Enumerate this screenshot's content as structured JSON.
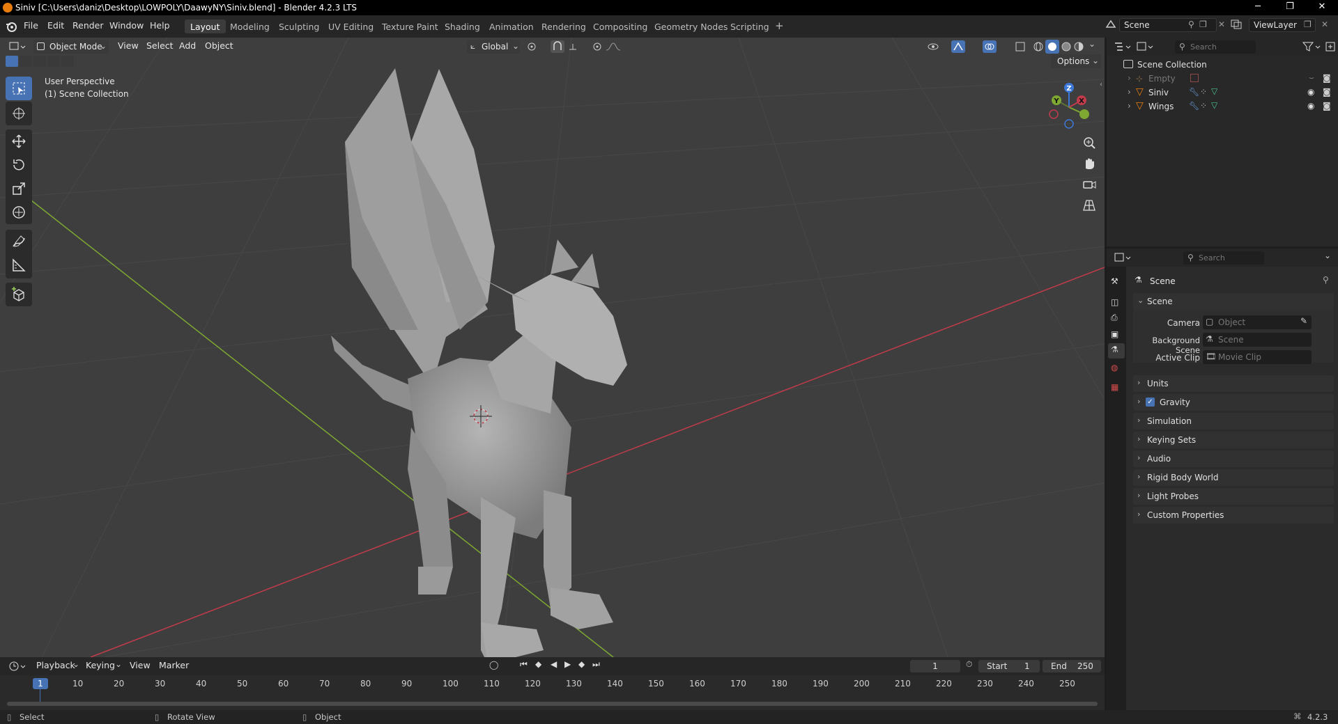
{
  "window": {
    "title": "Siniv [C:\\Users\\daniz\\Desktop\\LOWPOLY\\DaawyNY\\Siniv.blend] - Blender 4.2.3 LTS",
    "minimize": "─",
    "maximize": "❐",
    "close": "✕"
  },
  "menu": [
    "File",
    "Edit",
    "Render",
    "Window",
    "Help"
  ],
  "workspaces": [
    "Layout",
    "Modeling",
    "Sculpting",
    "UV Editing",
    "Texture Paint",
    "Shading",
    "Animation",
    "Rendering",
    "Compositing",
    "Geometry Nodes",
    "Scripting"
  ],
  "workspace_add": "+",
  "scene": {
    "label": "Scene",
    "viewlayer": "ViewLayer"
  },
  "viewport": {
    "mode": "Object Mode",
    "menus": [
      "View",
      "Select",
      "Add",
      "Object"
    ],
    "transform_orientation": "Global",
    "options": "Options",
    "perspective": "User Perspective",
    "collection": "(1) Scene Collection",
    "gizmo": {
      "x": "X",
      "y": "Y",
      "z": "Z"
    }
  },
  "outliner": {
    "search_placeholder": "Search",
    "root": "Scene Collection",
    "items": [
      {
        "name": "Empty"
      },
      {
        "name": "Siniv"
      },
      {
        "name": "Wings"
      }
    ]
  },
  "properties": {
    "search_placeholder": "Search",
    "context": "Scene",
    "section": "Scene",
    "camera_label": "Camera",
    "camera_value": "Object",
    "background_label": "Background Scene",
    "background_value": "Scene",
    "clip_label": "Active Clip",
    "clip_value": "Movie Clip",
    "panels": [
      "Units",
      "Gravity",
      "Simulation",
      "Keying Sets",
      "Audio",
      "Rigid Body World",
      "Light Probes",
      "Custom Properties"
    ],
    "gravity_checked": true
  },
  "timeline": {
    "menus": [
      "Playback",
      "Keying",
      "View",
      "Marker"
    ],
    "current_frame": "1",
    "start_label": "Start",
    "start": "1",
    "end_label": "End",
    "end": "250",
    "frames": [
      "10",
      "20",
      "30",
      "40",
      "50",
      "60",
      "70",
      "80",
      "90",
      "100",
      "110",
      "120",
      "130",
      "140",
      "150",
      "160",
      "170",
      "180",
      "190",
      "200",
      "210",
      "220",
      "230",
      "240",
      "250"
    ],
    "playhead": "1"
  },
  "status": {
    "select": "Select",
    "rotate": "Rotate View",
    "object": "Object",
    "version": "4.2.3"
  },
  "colors": {
    "accent": "#4772b3",
    "x_axis": "#c23b4a",
    "y_axis": "#7ea832",
    "z_axis": "#3c78d8",
    "viewport_bg": "#3e3e3e",
    "blender_orange": "#e87d0d"
  }
}
